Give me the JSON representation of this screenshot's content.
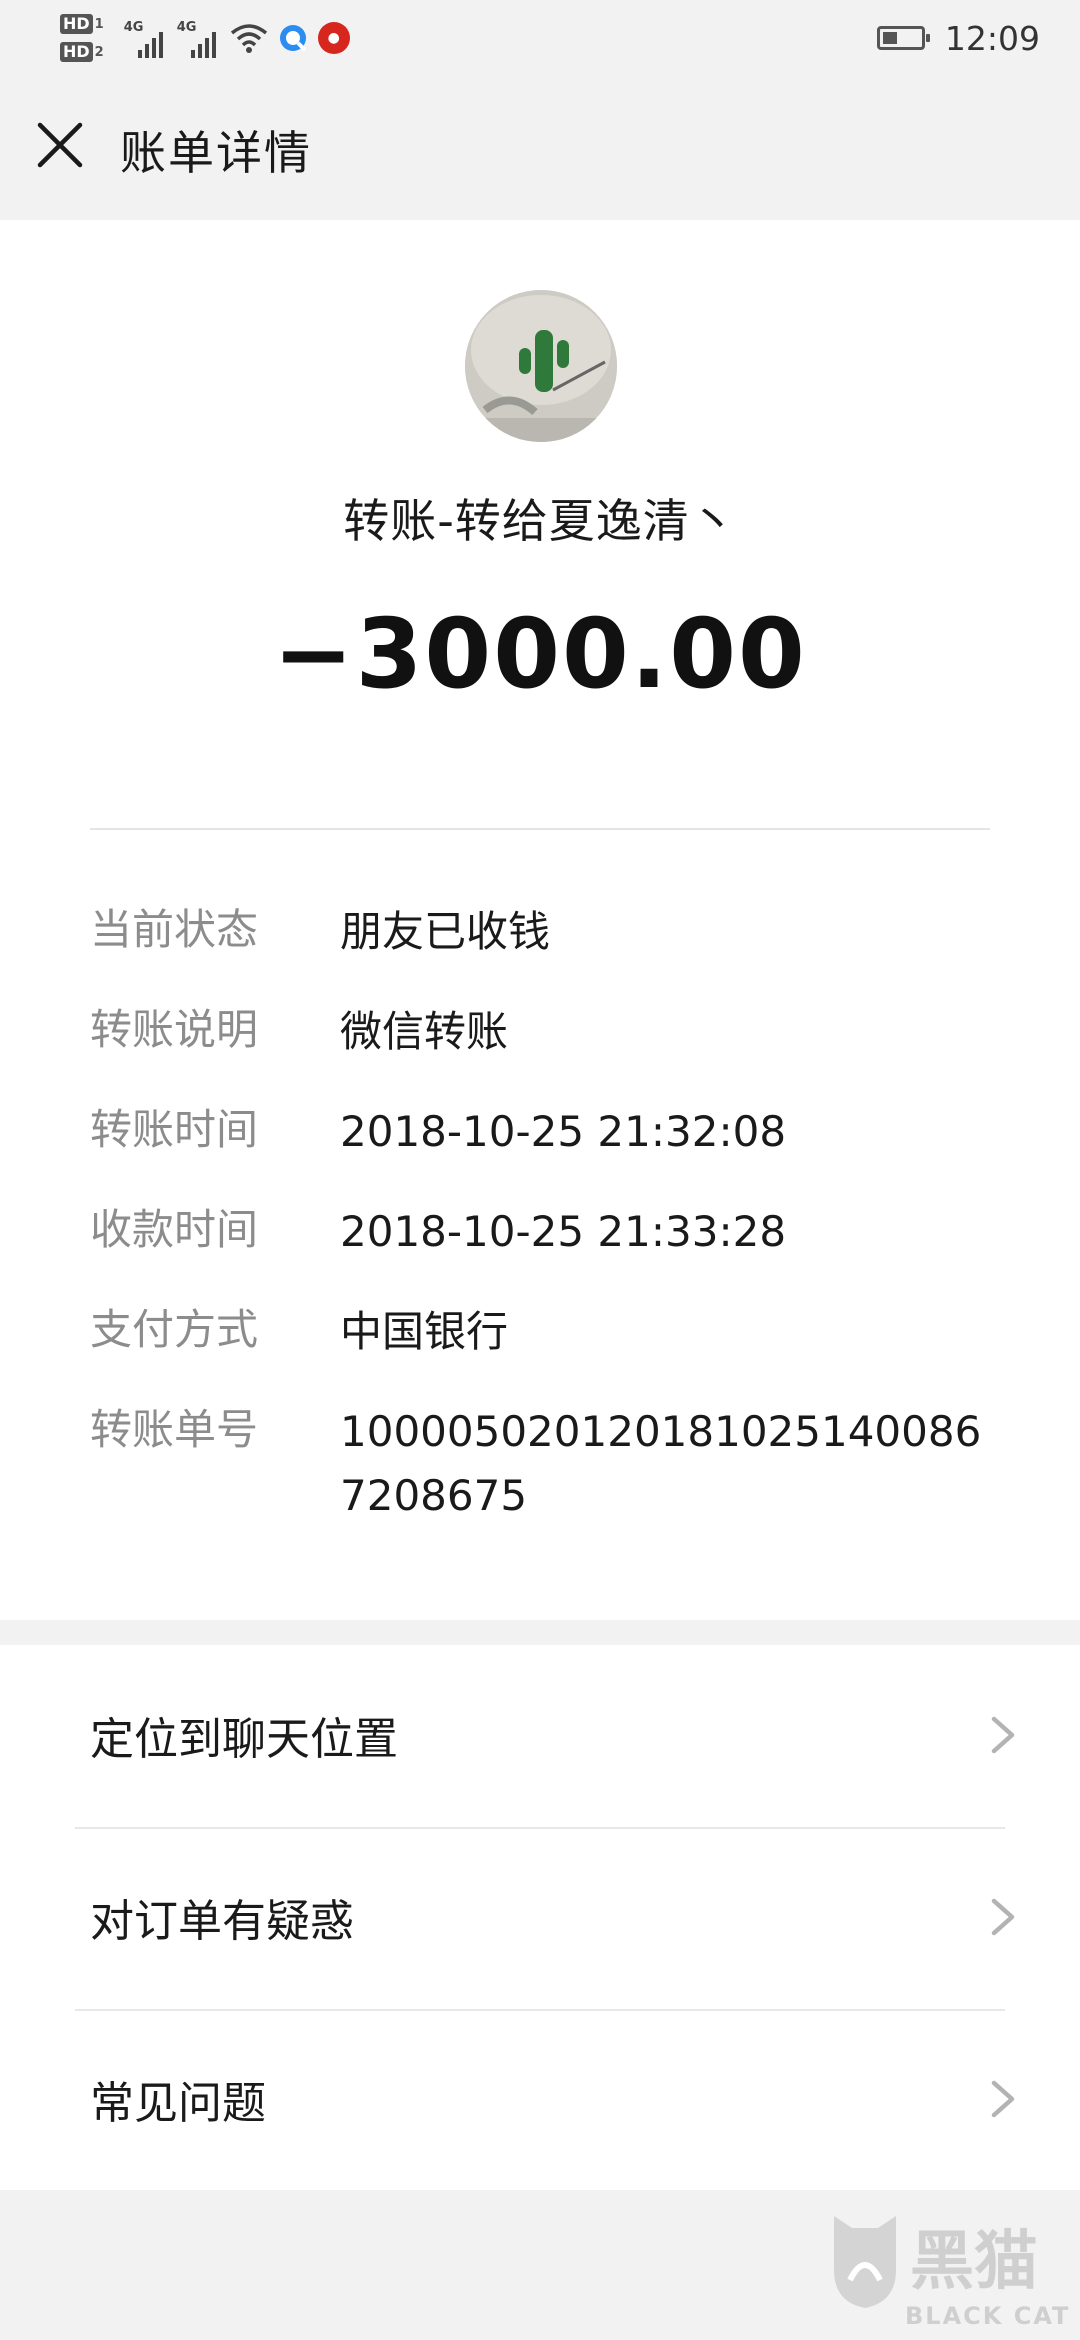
{
  "status_bar": {
    "hd1": "HD",
    "hd1_num": "1",
    "hd2": "HD",
    "hd2_num": "2",
    "sim1_network": "4G",
    "sim2_network": "4G",
    "time": "12:09",
    "icons": [
      "signal-icon",
      "wifi-icon",
      "browser-icon",
      "news-app-icon",
      "battery-icon"
    ]
  },
  "header": {
    "close_icon": "close-icon",
    "title": "账单详情"
  },
  "transaction": {
    "payee": "转账-转给夏逸清丶",
    "amount": "−3000.00",
    "fields": [
      {
        "label": "当前状态",
        "value": "朋友已收钱"
      },
      {
        "label": "转账说明",
        "value": "微信转账"
      },
      {
        "label": "转账时间",
        "value": "2018-10-25 21:32:08"
      },
      {
        "label": "收款时间",
        "value": "2018-10-25 21:33:28"
      },
      {
        "label": "支付方式",
        "value": "中国银行"
      },
      {
        "label": "转账单号",
        "value": "100005020120181025140086720867​5"
      }
    ]
  },
  "actions": [
    {
      "label": "定位到聊天位置",
      "icon": "chevron-right-icon"
    },
    {
      "label": "对订单有疑惑",
      "icon": "chevron-right-icon"
    },
    {
      "label": "常见问题",
      "icon": "chevron-right-icon"
    }
  ],
  "watermark": {
    "text": "黑猫",
    "sub": "BLACK CAT"
  },
  "colors": {
    "background": "#f2f2f2",
    "card": "#ffffff",
    "label_gray": "#8c8c8c",
    "text_dark": "#1a1a1a"
  }
}
